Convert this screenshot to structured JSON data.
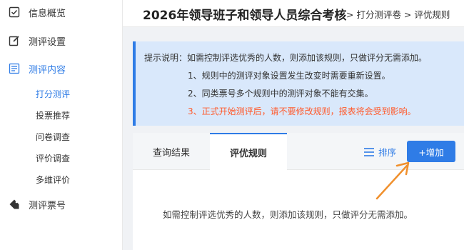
{
  "sidebar": {
    "items": [
      {
        "label": "信息概览",
        "icon": "checkbox-icon"
      },
      {
        "label": "测评设置",
        "icon": "edit-icon"
      },
      {
        "label": "测评内容",
        "icon": "list-icon",
        "active": true
      },
      {
        "label": "测评票号",
        "icon": "tag-icon"
      }
    ],
    "sub_items": [
      {
        "label": "打分测评",
        "active": true
      },
      {
        "label": "投票推荐"
      },
      {
        "label": "问卷调查"
      },
      {
        "label": "评价调查"
      },
      {
        "label": "多维评价"
      }
    ]
  },
  "header": {
    "title": "2026年领导班子和领导人员综合考核",
    "breadcrumb": "> 打分测评卷 > 评优规则"
  },
  "notice": {
    "lines": [
      "提示说明：如需控制评选优秀的人数，则添加该规则，只做评分无需添加。",
      "1、规则中的测评对象设置发生改变时需要重新设置。",
      "2、同类票号多个规则中的测评对象不能有交集。",
      "3、正式开始测评后，请不要修改规则，报表将会受到影响。"
    ],
    "warning_color": "#ff5a2c"
  },
  "tabs": [
    {
      "label": "查询结果"
    },
    {
      "label": "评优规则",
      "active": true
    }
  ],
  "toolbar": {
    "sort_label": "排序",
    "add_label": "+增加"
  },
  "empty_message": "如需控制评选优秀的人数，则添加该规则，只做评分无需添加。",
  "colors": {
    "accent": "#2f7ce6",
    "notice_bg": "#d9e8fb",
    "annotation_arrow": "#f0902d"
  }
}
